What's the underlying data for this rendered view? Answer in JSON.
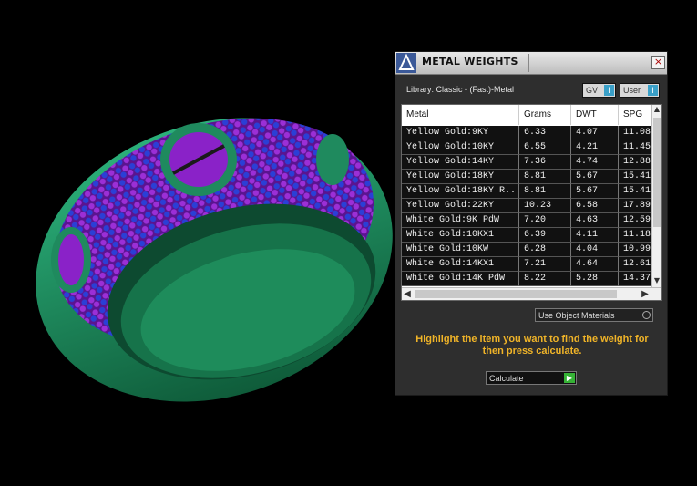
{
  "panel": {
    "title": "METAL WEIGHTS",
    "close_label": "×",
    "library": "Library: Classic - (Fast)-Metal",
    "toggle_gv": "GV",
    "toggle_user": "User",
    "toggle_knob": "I",
    "columns": [
      "Metal",
      "Grams",
      "DWT",
      "SPG"
    ],
    "rows": [
      [
        "Yellow Gold:9KY",
        "6.33",
        "4.07",
        "11.08"
      ],
      [
        "Yellow Gold:10KY",
        "6.55",
        "4.21",
        "11.45"
      ],
      [
        "Yellow Gold:14KY",
        "7.36",
        "4.74",
        "12.88"
      ],
      [
        "Yellow Gold:18KY",
        "8.81",
        "5.67",
        "15.41"
      ],
      [
        "Yellow Gold:18KY R...",
        "8.81",
        "5.67",
        "15.41"
      ],
      [
        "Yellow Gold:22KY",
        "10.23",
        "6.58",
        "17.89"
      ],
      [
        "White Gold:9K PdW",
        "7.20",
        "4.63",
        "12.59"
      ],
      [
        "White Gold:10KX1",
        "6.39",
        "4.11",
        "11.18"
      ],
      [
        "White Gold:10KW",
        "6.28",
        "4.04",
        "10.99"
      ],
      [
        "White Gold:14KX1",
        "7.21",
        "4.64",
        "12.61"
      ],
      [
        "White Gold:14K PdW",
        "8.22",
        "5.28",
        "14.37"
      ]
    ],
    "use_object_materials": "Use Object Materials",
    "hint": "Highlight the item you want to find the weight for then press calculate.",
    "calculate": "Calculate",
    "calc_arrow": "▶",
    "scroll_up": "▲",
    "scroll_down": "▼",
    "scroll_left": "◀",
    "scroll_right": "▶"
  },
  "colors": {
    "ring_metal": "#1f8a5e",
    "ring_pave": "#7a1fb5",
    "ring_stones": "#2a3fd8",
    "hint_text": "#f0b428",
    "toggle_accent": "#3aa0c8",
    "calc_go": "#35b235"
  }
}
